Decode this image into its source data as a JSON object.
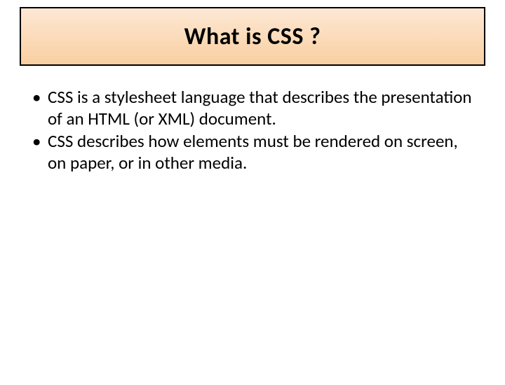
{
  "title": "What is CSS ?",
  "bullets": [
    "CSS is a stylesheet language that describes the presentation of an HTML (or XML) document.",
    "CSS describes how elements must be rendered on screen, on paper, or in other media."
  ]
}
